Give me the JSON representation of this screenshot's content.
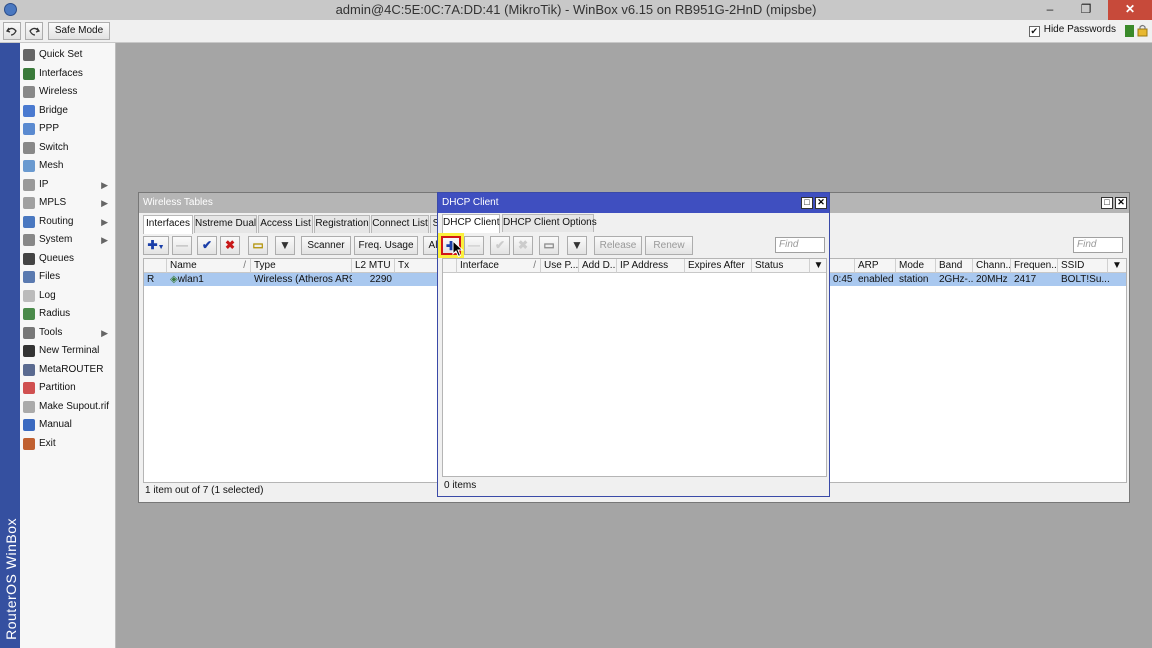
{
  "window": {
    "title": "admin@4C:5E:0C:7A:DD:41 (MikroTik) - WinBox v6.15 on RB951G-2HnD (mipsbe)",
    "minimize": "–",
    "restore": "❐",
    "close": "✕"
  },
  "toolbar": {
    "undo_icon": "undo-icon",
    "redo_icon": "redo-icon",
    "safe_mode_label": "Safe Mode",
    "hide_passwords_label": "Hide Passwords",
    "hide_passwords_checked": "✔"
  },
  "brand_label": "RouterOS WinBox",
  "sidebar": {
    "items": [
      {
        "label": "Quick Set",
        "icon": "quick-set-icon",
        "color": "#666666",
        "arrow": ""
      },
      {
        "label": "Interfaces",
        "icon": "interfaces-icon",
        "color": "#3a7a3a",
        "arrow": ""
      },
      {
        "label": "Wireless",
        "icon": "wireless-icon",
        "color": "#888888",
        "arrow": ""
      },
      {
        "label": "Bridge",
        "icon": "bridge-icon",
        "color": "#4a7ad0",
        "arrow": ""
      },
      {
        "label": "PPP",
        "icon": "ppp-icon",
        "color": "#5a8ad0",
        "arrow": ""
      },
      {
        "label": "Switch",
        "icon": "switch-icon",
        "color": "#888888",
        "arrow": ""
      },
      {
        "label": "Mesh",
        "icon": "mesh-icon",
        "color": "#6a9ad0",
        "arrow": ""
      },
      {
        "label": "IP",
        "icon": "ip-icon",
        "color": "#999999",
        "arrow": "▶"
      },
      {
        "label": "MPLS",
        "icon": "mpls-icon",
        "color": "#a0a0a0",
        "arrow": "▶"
      },
      {
        "label": "Routing",
        "icon": "routing-icon",
        "color": "#4a78c0",
        "arrow": "▶"
      },
      {
        "label": "System",
        "icon": "system-icon",
        "color": "#888888",
        "arrow": "▶"
      },
      {
        "label": "Queues",
        "icon": "queues-icon",
        "color": "#444444",
        "arrow": ""
      },
      {
        "label": "Files",
        "icon": "files-icon",
        "color": "#5a7ab0",
        "arrow": ""
      },
      {
        "label": "Log",
        "icon": "log-icon",
        "color": "#bbbbbb",
        "arrow": ""
      },
      {
        "label": "Radius",
        "icon": "radius-icon",
        "color": "#4a8a4a",
        "arrow": ""
      },
      {
        "label": "Tools",
        "icon": "tools-icon",
        "color": "#777777",
        "arrow": "▶"
      },
      {
        "label": "New Terminal",
        "icon": "terminal-icon",
        "color": "#333333",
        "arrow": ""
      },
      {
        "label": "MetaROUTER",
        "icon": "metarouter-icon",
        "color": "#5a6a90",
        "arrow": ""
      },
      {
        "label": "Partition",
        "icon": "partition-icon",
        "color": "#d05050",
        "arrow": ""
      },
      {
        "label": "Make Supout.rif",
        "icon": "supout-icon",
        "color": "#aaaaaa",
        "arrow": ""
      },
      {
        "label": "Manual",
        "icon": "manual-icon",
        "color": "#3a6ac0",
        "arrow": ""
      },
      {
        "label": "Exit",
        "icon": "exit-icon",
        "color": "#c06030",
        "arrow": ""
      }
    ]
  },
  "wireless_tables": {
    "title": "Wireless Tables",
    "tabs": [
      "Interfaces",
      "Nstreme Dual",
      "Access List",
      "Registration",
      "Connect List",
      "S"
    ],
    "buttons": {
      "add": "✚",
      "remove": "—",
      "enable": "✔",
      "disable": "✖",
      "comment": "▭",
      "filter": "▼",
      "scanner": "Scanner",
      "freq_usage": "Freq. Usage",
      "more": "Al"
    },
    "find_placeholder": "Find",
    "columns_left": [
      "",
      "Name",
      "Type",
      "L2 MTU",
      "Tx"
    ],
    "columns_right": [
      "ARP",
      "Mode",
      "Band",
      "Chann...",
      "Frequen...",
      "SSID"
    ],
    "row": {
      "flag": "R",
      "name": "wlan1",
      "type": "Wireless (Atheros AR9...",
      "l2mtu": "2290",
      "tail": "0:45",
      "arp": "enabled",
      "mode": "station",
      "band": "2GHz-...",
      "channel": "20MHz",
      "freq": "2417",
      "ssid": "BOLT!Su..."
    },
    "status": "1 item out of 7 (1 selected)"
  },
  "dhcp_client": {
    "title": "DHCP Client",
    "tabs": [
      "DHCP Client",
      "DHCP Client Options"
    ],
    "buttons": {
      "add": "✚",
      "remove": "—",
      "enable": "✔",
      "disable": "✖",
      "comment": "▭",
      "filter": "▼",
      "release": "Release",
      "renew": "Renew"
    },
    "find_placeholder": "Find",
    "columns": [
      "Interface",
      "Use P...",
      "Add D...",
      "IP Address",
      "Expires After",
      "Status"
    ],
    "status": "0 items"
  }
}
